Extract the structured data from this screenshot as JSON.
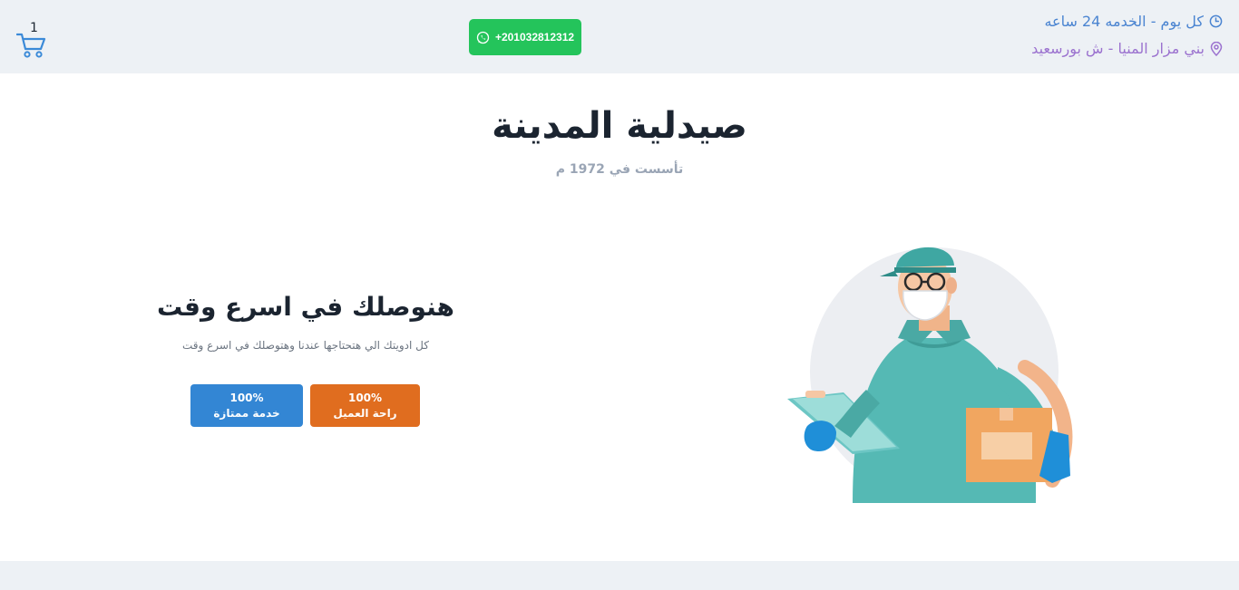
{
  "header": {
    "cart_count": "1",
    "whatsapp_number": "+201032812312",
    "hours_text": "كل يوم - الخدمه 24 ساعه",
    "address_text": "بني مزار المنيا - ش بورسعيد",
    "icons": {
      "cart": "shopping-cart-icon",
      "whatsapp": "whatsapp-icon",
      "clock": "clock-icon",
      "location": "location-pin-icon"
    }
  },
  "hero": {
    "title": "صيدلية المدينة",
    "subtitle": "تأسست في 1972 م",
    "heading": "هنوصلك في اسرع وقت",
    "description": "كل ادويتك الي هتحتاجها عندنا وهتوصلك في اسرع وقت",
    "badges": [
      {
        "percent": "100%",
        "label": "راحة العميل"
      },
      {
        "percent": "100%",
        "label": "خدمة ممتازة"
      }
    ]
  },
  "colors": {
    "topbar_bg": "#edf1f5",
    "whatsapp_green": "#24c45b",
    "hours_blue": "#4a84d1",
    "address_purple": "#9b72cf",
    "badge_orange": "#e06d1f",
    "badge_blue": "#3386d4"
  }
}
